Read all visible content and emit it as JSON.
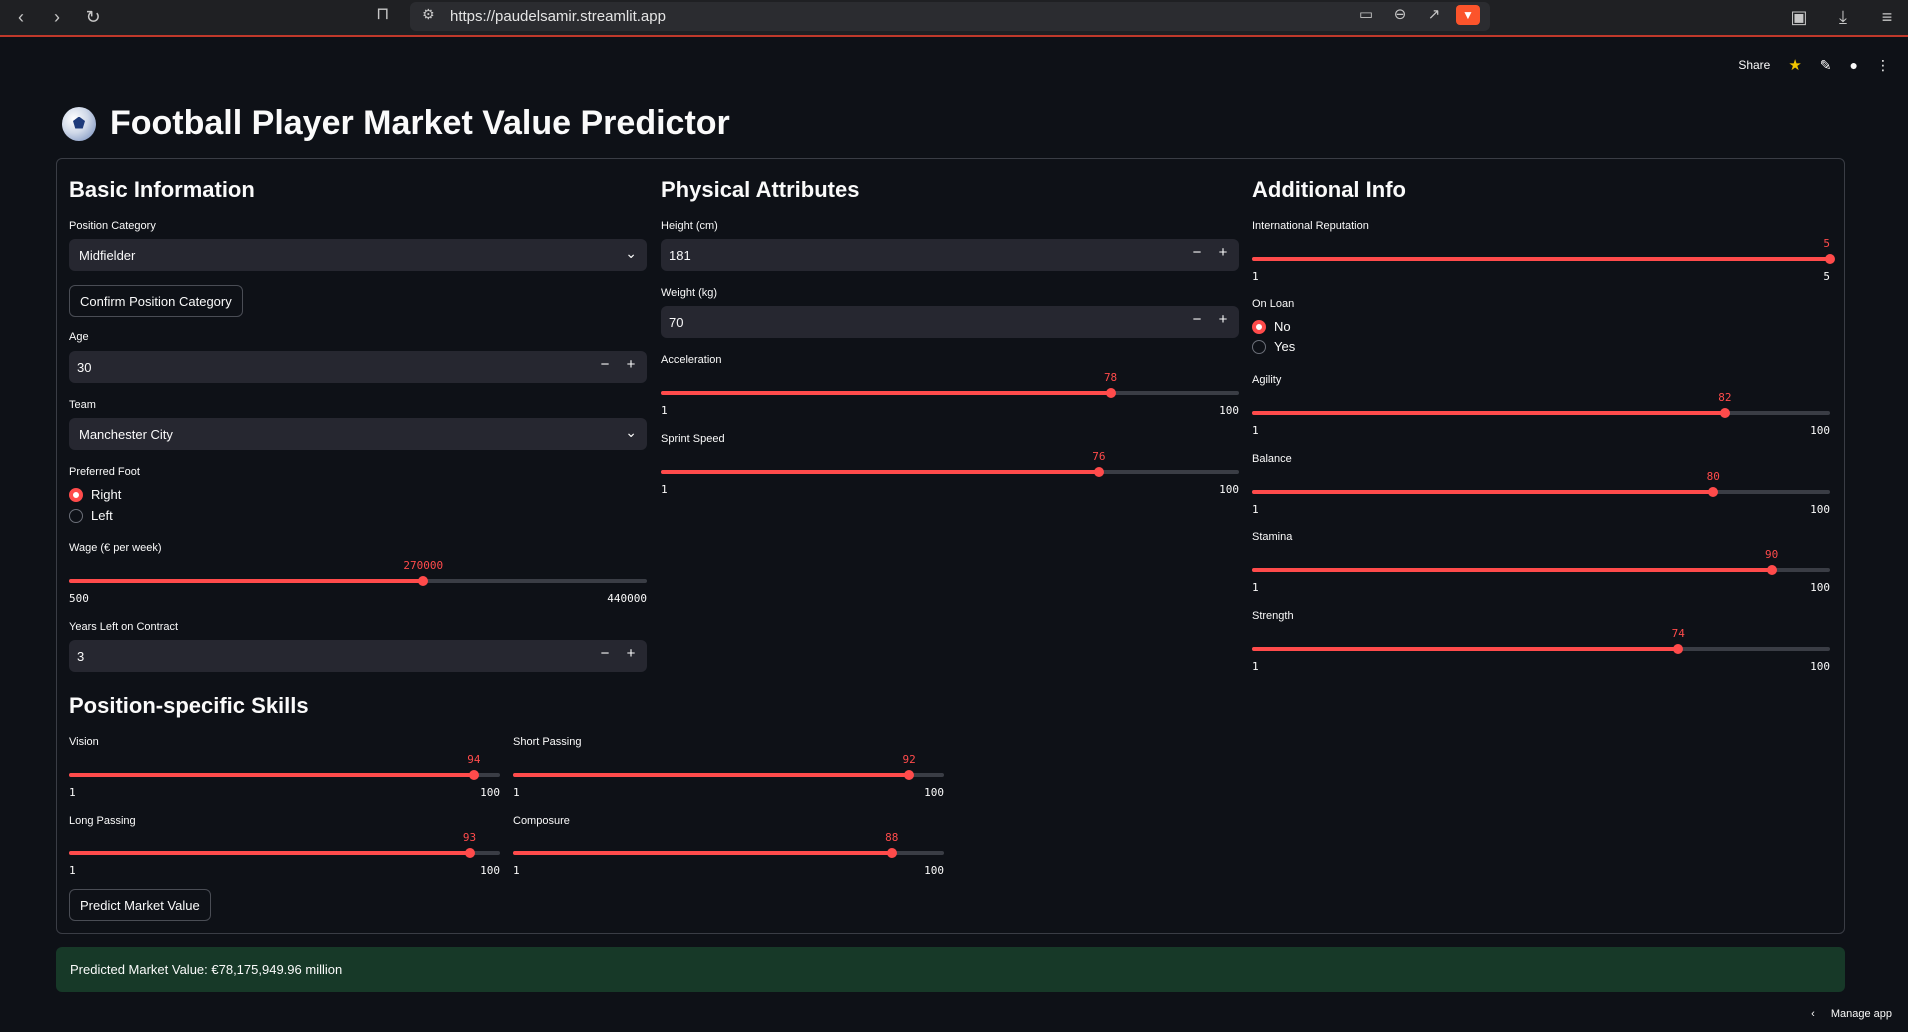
{
  "browser": {
    "url": "https://paudelsamir.streamlit.app"
  },
  "header": {
    "share_label": "Share"
  },
  "page": {
    "title": "Football Player Market Value Predictor"
  },
  "basic": {
    "heading": "Basic Information",
    "position_label": "Position Category",
    "position_value": "Midfielder",
    "confirm_button": "Confirm Position Category",
    "age_label": "Age",
    "age_value": "30",
    "team_label": "Team",
    "team_value": "Manchester City",
    "foot_label": "Preferred Foot",
    "foot_options": [
      "Right",
      "Left"
    ],
    "foot_selected": "Right",
    "wage_label": "Wage (€ per week)",
    "wage": {
      "value": "270000",
      "min": "500",
      "max": "440000",
      "fraction": 0.6129
    },
    "contract_label": "Years Left on Contract",
    "contract_value": "3"
  },
  "physical": {
    "heading": "Physical Attributes",
    "height_label": "Height (cm)",
    "height_value": "181",
    "weight_label": "Weight (kg)",
    "weight_value": "70",
    "acceleration_label": "Acceleration",
    "acceleration": {
      "value": "78",
      "min": "1",
      "max": "100",
      "fraction": 0.7778
    },
    "sprint_label": "Sprint Speed",
    "sprint": {
      "value": "76",
      "min": "1",
      "max": "100",
      "fraction": 0.7576
    }
  },
  "additional": {
    "heading": "Additional Info",
    "reputation_label": "International Reputation",
    "reputation": {
      "value": "5",
      "min": "1",
      "max": "5",
      "fraction": 1.0
    },
    "loan_label": "On Loan",
    "loan_options": [
      "No",
      "Yes"
    ],
    "loan_selected": "No",
    "agility_label": "Agility",
    "agility": {
      "value": "82",
      "min": "1",
      "max": "100",
      "fraction": 0.8182
    },
    "balance_label": "Balance",
    "balance": {
      "value": "80",
      "min": "1",
      "max": "100",
      "fraction": 0.798
    },
    "stamina_label": "Stamina",
    "stamina": {
      "value": "90",
      "min": "1",
      "max": "100",
      "fraction": 0.899
    },
    "strength_label": "Strength",
    "strength": {
      "value": "74",
      "min": "1",
      "max": "100",
      "fraction": 0.7374
    }
  },
  "skills": {
    "heading": "Position-specific Skills",
    "vision_label": "Vision",
    "vision": {
      "value": "94",
      "min": "1",
      "max": "100",
      "fraction": 0.9394
    },
    "short_passing_label": "Short Passing",
    "short_passing": {
      "value": "92",
      "min": "1",
      "max": "100",
      "fraction": 0.9192
    },
    "long_passing_label": "Long Passing",
    "long_passing": {
      "value": "93",
      "min": "1",
      "max": "100",
      "fraction": 0.9293
    },
    "composure_label": "Composure",
    "composure": {
      "value": "88",
      "min": "1",
      "max": "100",
      "fraction": 0.8788
    },
    "predict_button": "Predict Market Value"
  },
  "result": {
    "text": "Predicted Market Value: €78,175,949.96 million"
  },
  "footer": {
    "manage_label": "Manage app"
  },
  "colors": {
    "accent": "#ff4b4b",
    "background": "#0e1117",
    "input_bg": "#262730",
    "success_bg": "#173928"
  }
}
